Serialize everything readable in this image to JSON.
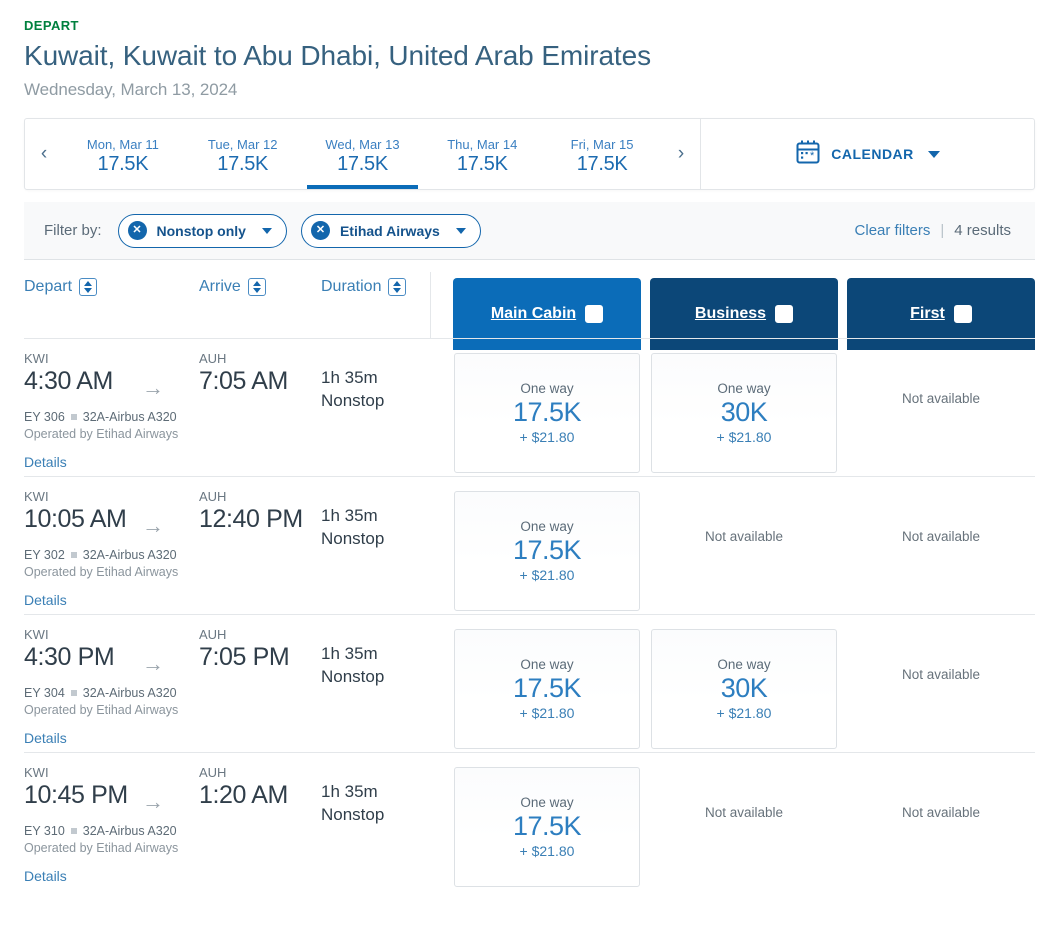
{
  "header": {
    "depart_label": "DEPART",
    "route_title": "Kuwait, Kuwait to Abu Dhabi, United Arab Emirates",
    "route_date": "Wednesday, March 13, 2024"
  },
  "date_strip": {
    "prev_icon": "‹",
    "next_icon": "›",
    "days": [
      {
        "label": "Mon, Mar 11",
        "price": "17.5K",
        "active": false
      },
      {
        "label": "Tue, Mar 12",
        "price": "17.5K",
        "active": false
      },
      {
        "label": "Wed, Mar 13",
        "price": "17.5K",
        "active": true
      },
      {
        "label": "Thu, Mar 14",
        "price": "17.5K",
        "active": false
      },
      {
        "label": "Fri, Mar 15",
        "price": "17.5K",
        "active": false
      }
    ],
    "calendar_label": "CALENDAR"
  },
  "filters": {
    "filter_by_label": "Filter by:",
    "chips": [
      {
        "label": "Nonstop only",
        "remove_icon": "✕"
      },
      {
        "label": "Etihad Airways",
        "remove_icon": "✕"
      }
    ],
    "clear_filters": "Clear filters",
    "separator": "|",
    "results_count": "4 results"
  },
  "columns": {
    "depart": "Depart",
    "arrive": "Arrive",
    "duration": "Duration"
  },
  "fare_columns": [
    {
      "label": "Main Cabin",
      "color": "#0b6cb8"
    },
    {
      "label": "Business",
      "color": "#0c4778"
    },
    {
      "label": "First",
      "color": "#0c4778"
    }
  ],
  "labels": {
    "not_available": "Not available",
    "details": "Details",
    "one_way": "One way",
    "arrow_icon": "→"
  },
  "flights": [
    {
      "depart_code": "KWI",
      "depart_time": "4:30 AM",
      "arrive_code": "AUH",
      "arrive_time": "7:05 AM",
      "duration": "1h 35m",
      "stops": "Nonstop",
      "flight_number": "EY 306",
      "aircraft": "32A-Airbus A320",
      "operated_by": "Operated by Etihad Airways",
      "details": "Details",
      "fares": [
        {
          "available": true,
          "one_way": "One way",
          "miles": "17.5K",
          "tax": "+ $21.80"
        },
        {
          "available": true,
          "one_way": "One way",
          "miles": "30K",
          "tax": "+ $21.80"
        },
        {
          "available": false,
          "text": "Not available"
        }
      ]
    },
    {
      "depart_code": "KWI",
      "depart_time": "10:05 AM",
      "arrive_code": "AUH",
      "arrive_time": "12:40 PM",
      "duration": "1h 35m",
      "stops": "Nonstop",
      "flight_number": "EY 302",
      "aircraft": "32A-Airbus A320",
      "operated_by": "Operated by Etihad Airways",
      "details": "Details",
      "fares": [
        {
          "available": true,
          "one_way": "One way",
          "miles": "17.5K",
          "tax": "+ $21.80"
        },
        {
          "available": false,
          "text": "Not available"
        },
        {
          "available": false,
          "text": "Not available"
        }
      ]
    },
    {
      "depart_code": "KWI",
      "depart_time": "4:30 PM",
      "arrive_code": "AUH",
      "arrive_time": "7:05 PM",
      "duration": "1h 35m",
      "stops": "Nonstop",
      "flight_number": "EY 304",
      "aircraft": "32A-Airbus A320",
      "operated_by": "Operated by Etihad Airways",
      "details": "Details",
      "fares": [
        {
          "available": true,
          "one_way": "One way",
          "miles": "17.5K",
          "tax": "+ $21.80"
        },
        {
          "available": true,
          "one_way": "One way",
          "miles": "30K",
          "tax": "+ $21.80"
        },
        {
          "available": false,
          "text": "Not available"
        }
      ]
    },
    {
      "depart_code": "KWI",
      "depart_time": "10:45 PM",
      "arrive_code": "AUH",
      "arrive_time": "1:20 AM",
      "duration": "1h 35m",
      "stops": "Nonstop",
      "flight_number": "EY 310",
      "aircraft": "32A-Airbus A320",
      "operated_by": "Operated by Etihad Airways",
      "details": "Details",
      "fares": [
        {
          "available": true,
          "one_way": "One way",
          "miles": "17.5K",
          "tax": "+ $21.80"
        },
        {
          "available": false,
          "text": "Not available"
        },
        {
          "available": false,
          "text": "Not available"
        }
      ]
    }
  ],
  "colors": {
    "accent_green": "#00803e",
    "brand_blue": "#0b6cb8",
    "brand_navy": "#0c4778",
    "link_blue": "#3a7fb5"
  }
}
